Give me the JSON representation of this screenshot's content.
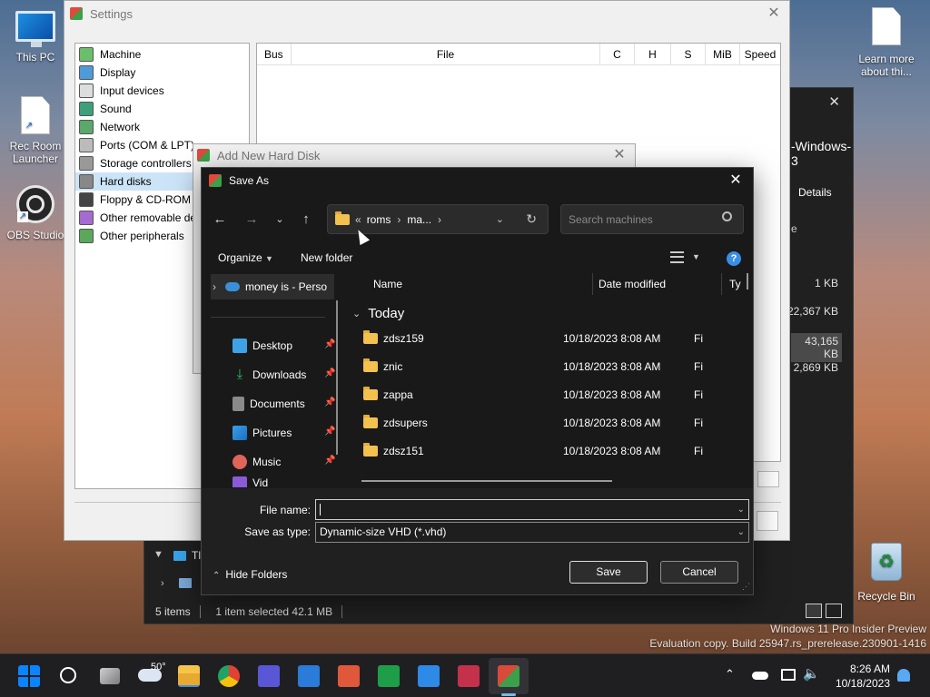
{
  "desktop": {
    "icons": [
      {
        "label": "This PC"
      },
      {
        "label": "Rec Room Launcher"
      },
      {
        "label": "OBS Studio"
      },
      {
        "label": "Learn more about thi..."
      },
      {
        "label": "Recycle Bin"
      }
    ],
    "watermark": {
      "line1": "Windows 11 Pro Insider Preview",
      "line2": "Evaluation copy. Build 25947.rs_prerelease.230901-1416"
    }
  },
  "settings": {
    "title": "Settings",
    "categories": [
      {
        "label": "Machine"
      },
      {
        "label": "Display"
      },
      {
        "label": "Input devices"
      },
      {
        "label": "Sound"
      },
      {
        "label": "Network"
      },
      {
        "label": "Ports (COM & LPT)"
      },
      {
        "label": "Storage controllers"
      },
      {
        "label": "Hard disks"
      },
      {
        "label": "Floppy & CD-ROM d"
      },
      {
        "label": "Other removable de"
      },
      {
        "label": "Other peripherals"
      }
    ],
    "selected_index": 7,
    "disk_columns": {
      "bus": "Bus",
      "file": "File",
      "c": "C",
      "h": "H",
      "s": "S",
      "mib": "MiB",
      "speed": "Speed"
    }
  },
  "add_disk": {
    "title": "Add New Hard Disk"
  },
  "bg_explorer": {
    "title_fragment": "-Windows-3",
    "details_label": "Details",
    "col_fragment": "e",
    "sizes": [
      "1 KB",
      "22,367 KB",
      "43,165 KB",
      "2,869 KB"
    ],
    "tree_fragment": "Tl",
    "status": {
      "items": "5 items",
      "selected": "1 item selected  42.1 MB"
    },
    "close_glyph": "✕"
  },
  "save_as": {
    "title": "Save As",
    "address": {
      "prefix": "«",
      "segments": [
        "roms",
        "ma..."
      ]
    },
    "search_placeholder": "Search machines",
    "toolbar": {
      "organize": "Organize",
      "new_folder": "New folder"
    },
    "nav": [
      {
        "label": "money is - Perso",
        "icon": "cloud-icon"
      },
      {
        "label": "Desktop",
        "icon": "desktop-icon"
      },
      {
        "label": "Downloads",
        "icon": "download-icon"
      },
      {
        "label": "Documents",
        "icon": "documents-icon"
      },
      {
        "label": "Pictures",
        "icon": "pictures-icon"
      },
      {
        "label": "Music",
        "icon": "music-icon"
      },
      {
        "label": "Vid",
        "icon": "videos-icon"
      }
    ],
    "columns": {
      "name": "Name",
      "date": "Date modified",
      "type": "Ty"
    },
    "group": "Today",
    "files": [
      {
        "name": "zdsz159",
        "date": "10/18/2023 8:08 AM",
        "type": "Fi"
      },
      {
        "name": "znic",
        "date": "10/18/2023 8:08 AM",
        "type": "Fi"
      },
      {
        "name": "zappa",
        "date": "10/18/2023 8:08 AM",
        "type": "Fi"
      },
      {
        "name": "zdsupers",
        "date": "10/18/2023 8:08 AM",
        "type": "Fi"
      },
      {
        "name": "zdsz151",
        "date": "10/18/2023 8:08 AM",
        "type": "Fi"
      }
    ],
    "file_name_label": "File name:",
    "file_name_value": "",
    "save_type_label": "Save as type:",
    "save_type_value": "Dynamic-size VHD (*.vhd)",
    "hide_folders": "Hide Folders",
    "save_button": "Save",
    "cancel_button": "Cancel"
  },
  "taskbar": {
    "weather_temp": "50°",
    "time": "8:26 AM",
    "date": "10/18/2023"
  },
  "colors": {
    "accent": "#0078d4",
    "folder": "#f2c14e"
  }
}
